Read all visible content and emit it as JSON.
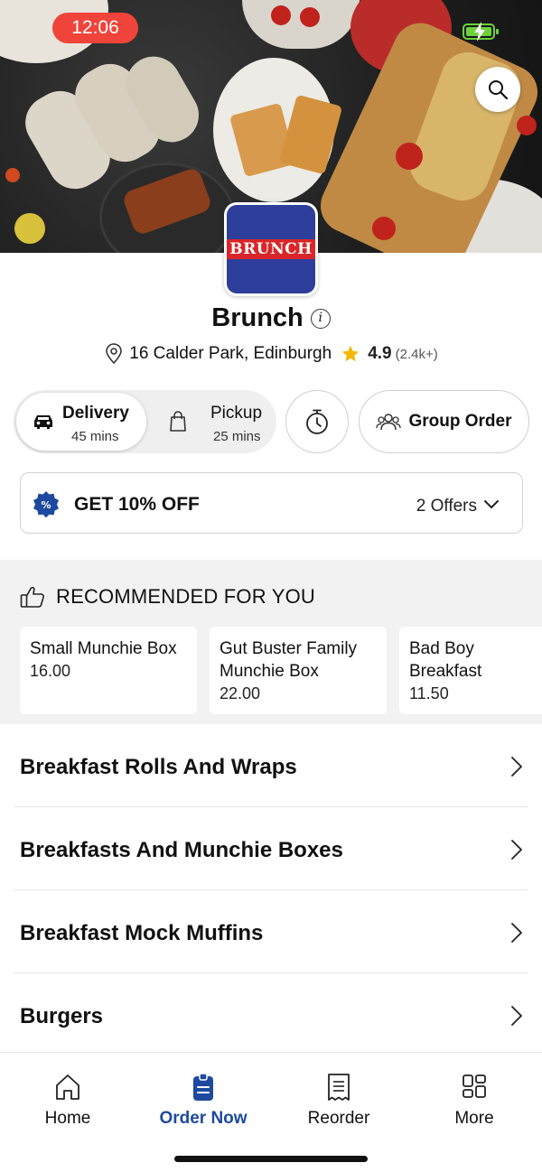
{
  "status": {
    "time": "12:06"
  },
  "colors": {
    "accent": "#1d4a9e",
    "star": "#f5b800",
    "status_pill": "#f0443a",
    "logo_bg": "#2d3f9a",
    "logo_red": "#d8262a"
  },
  "hero": {
    "search_icon": "search-icon"
  },
  "restaurant": {
    "logo_text": "BRUNCH",
    "name": "Brunch",
    "address": "16 Calder Park, Edinburgh",
    "rating": "4.9",
    "rating_count": "(2.4k+)"
  },
  "modes": {
    "delivery": {
      "label": "Delivery",
      "time": "45 mins",
      "selected": true
    },
    "pickup": {
      "label": "Pickup",
      "time": "25 mins",
      "selected": false
    }
  },
  "group_order": {
    "label": "Group Order"
  },
  "offers": {
    "title": "GET 10% OFF",
    "count_label": "2 Offers"
  },
  "recommended": {
    "title": "RECOMMENDED FOR YOU",
    "items": [
      {
        "name": "Small Munchie Box",
        "price": "16.00"
      },
      {
        "name": "Gut Buster Family Munchie Box",
        "price": "22.00"
      },
      {
        "name": "Bad Boy Breakfast",
        "price": "11.50"
      }
    ]
  },
  "categories": [
    "Breakfast Rolls And Wraps",
    "Breakfasts And Munchie Boxes",
    "Breakfast Mock Muffins",
    "Burgers"
  ],
  "nav": [
    {
      "label": "Home",
      "icon": "home-icon",
      "active": false
    },
    {
      "label": "Order Now",
      "icon": "order-icon",
      "active": true
    },
    {
      "label": "Reorder",
      "icon": "receipt-icon",
      "active": false
    },
    {
      "label": "More",
      "icon": "grid-icon",
      "active": false
    }
  ]
}
